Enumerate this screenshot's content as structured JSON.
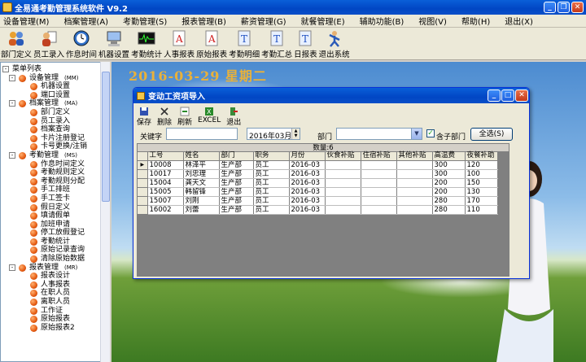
{
  "app": {
    "title": "全易通考勤管理系统软件  V9.2"
  },
  "menu": [
    {
      "label": "设备管理(M)"
    },
    {
      "label": "档案管理(A)"
    },
    {
      "label": "考勤管理(S)"
    },
    {
      "label": "报表管理(B)"
    },
    {
      "label": "薪资管理(G)"
    },
    {
      "label": "就餐管理(E)"
    },
    {
      "label": "辅助功能(B)"
    },
    {
      "label": "视图(V)"
    },
    {
      "label": "帮助(H)"
    },
    {
      "label": "退出(X)"
    }
  ],
  "toolbar": [
    {
      "label": "部门定义",
      "icon": "group-icon"
    },
    {
      "label": "员工录入",
      "icon": "person-icon"
    },
    {
      "label": "作息时间",
      "icon": "clock-icon"
    },
    {
      "label": "机器设置",
      "icon": "computer-icon"
    },
    {
      "label": "考勤统计",
      "icon": "monitor-icon"
    },
    {
      "label": "人事报表",
      "icon": "report-a-icon"
    },
    {
      "label": "原始报表",
      "icon": "report-a2-icon"
    },
    {
      "label": "考勤明细",
      "icon": "document-t-icon"
    },
    {
      "label": "考勤汇总",
      "icon": "document-t2-icon"
    },
    {
      "label": "日报表",
      "icon": "document-t3-icon"
    },
    {
      "label": "退出系统",
      "icon": "exit-person-icon"
    }
  ],
  "tree": {
    "root": "菜单列表",
    "items": [
      {
        "label": "设备管理",
        "badge": "(MM)",
        "level": 1,
        "expand": "-"
      },
      {
        "label": "机器设置",
        "level": 2
      },
      {
        "label": "端口设置",
        "level": 2
      },
      {
        "label": "档案管理",
        "badge": "(MA)",
        "level": 1,
        "expand": "-"
      },
      {
        "label": "部门定义",
        "level": 2
      },
      {
        "label": "员工录入",
        "level": 2
      },
      {
        "label": "档案查询",
        "level": 2
      },
      {
        "label": "卡片注册登记",
        "level": 2
      },
      {
        "label": "卡号更换/注销",
        "level": 2
      },
      {
        "label": "考勤管理",
        "badge": "(MS)",
        "level": 1,
        "expand": "-"
      },
      {
        "label": "作息时间定义",
        "level": 2
      },
      {
        "label": "考勤规则定义",
        "level": 2
      },
      {
        "label": "考勤规则分配",
        "level": 2
      },
      {
        "label": "手工排班",
        "level": 2
      },
      {
        "label": "手工签卡",
        "level": 2
      },
      {
        "label": "假日定义",
        "level": 2
      },
      {
        "label": "填请假单",
        "level": 2
      },
      {
        "label": "加班申请",
        "level": 2
      },
      {
        "label": "停工放假登记",
        "level": 2
      },
      {
        "label": "考勤统计",
        "level": 2
      },
      {
        "label": "原始记录查询",
        "level": 2
      },
      {
        "label": "清除原始数据",
        "level": 2
      },
      {
        "label": "报表管理",
        "badge": "(MR)",
        "level": 1,
        "expand": "-"
      },
      {
        "label": "报表设计",
        "level": 2
      },
      {
        "label": "人事报表",
        "level": 2
      },
      {
        "label": "在职人员",
        "level": 2
      },
      {
        "label": "离职人员",
        "level": 2
      },
      {
        "label": "工作证",
        "level": 2
      },
      {
        "label": "原始报表",
        "level": 2
      },
      {
        "label": "原始报表2",
        "level": 2
      }
    ]
  },
  "date_banner": "2016-03-29  星期二",
  "dialog": {
    "title": "变动工资项导入",
    "tools": [
      {
        "label": "保存",
        "icon": "save-icon"
      },
      {
        "label": "删除",
        "icon": "delete-icon"
      },
      {
        "label": "刷新",
        "icon": "refresh-icon"
      },
      {
        "label": "EXCEL",
        "icon": "excel-icon"
      },
      {
        "label": "退出",
        "icon": "exit-icon"
      }
    ],
    "keyword_label": "关键字",
    "keyword_value": "",
    "month_value": "2016年03月",
    "dept_label": "部门",
    "dept_value": "",
    "include_sub_label": "含子部门",
    "include_sub_checked": true,
    "select_all_label": "全选(S)",
    "count_label": "数量:6",
    "columns": [
      "工号",
      "姓名",
      "部门",
      "职务",
      "月份",
      "伙食补贴",
      "住宿补贴",
      "其他补贴",
      "高温费",
      "夜餐补助"
    ],
    "rows": [
      [
        "10008",
        "林泽平",
        "生产部",
        "员工",
        "2016-03",
        "",
        "",
        "",
        "300",
        "120"
      ],
      [
        "10017",
        "刘忠理",
        "生产部",
        "员工",
        "2016-03",
        "",
        "",
        "",
        "300",
        "100"
      ],
      [
        "15004",
        "龚天文",
        "生产部",
        "员工",
        "2016-03",
        "",
        "",
        "",
        "200",
        "150"
      ],
      [
        "15005",
        "韩留锋",
        "生产部",
        "员工",
        "2016-03",
        "",
        "",
        "",
        "200",
        "130"
      ],
      [
        "15007",
        "刘刚",
        "生产部",
        "员工",
        "2016-03",
        "",
        "",
        "",
        "280",
        "170"
      ],
      [
        "16002",
        "刘蕾",
        "生产部",
        "员工",
        "2016-03",
        "",
        "",
        "",
        "280",
        "110"
      ]
    ]
  },
  "colors": {
    "title_blue": "#0146c4",
    "date_gold": "#e9b13a",
    "xp_face": "#ece9d8"
  }
}
